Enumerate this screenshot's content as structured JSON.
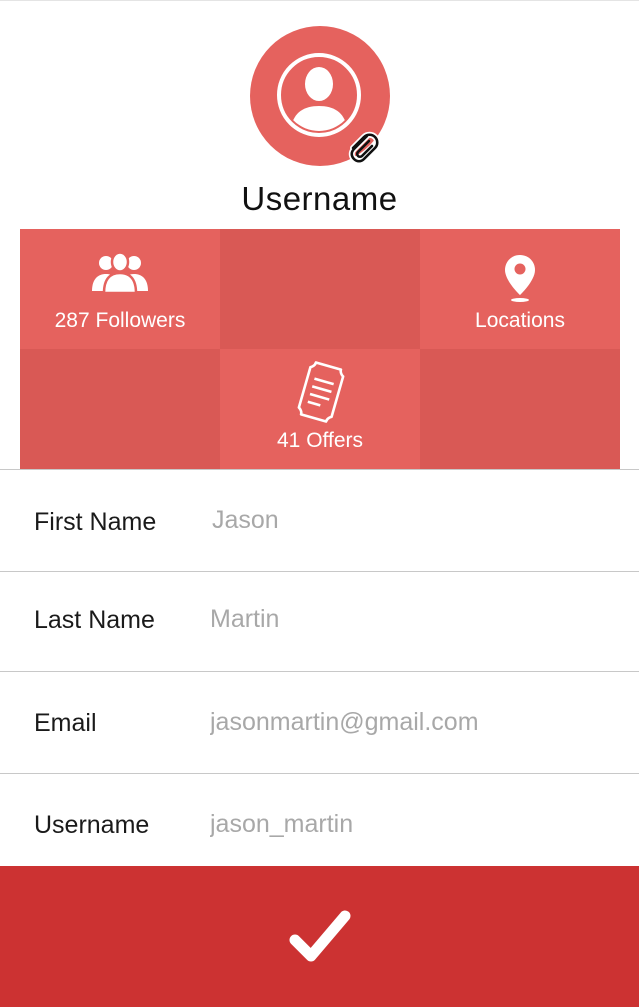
{
  "profile": {
    "username": "Username",
    "avatar_icon": "user-silhouette-icon",
    "attach_icon": "paperclip-icon"
  },
  "stats": {
    "followers_label": "287 Followers",
    "followers_icon": "group-icon",
    "locations_label": "Locations",
    "locations_icon": "map-pin-icon",
    "offers_label": "41 Offers",
    "offers_icon": "ticket-icon"
  },
  "form": {
    "first_name": {
      "label": "First Name",
      "value": "Jason"
    },
    "last_name": {
      "label": "Last Name",
      "value": "Martin"
    },
    "email": {
      "label": "Email",
      "value": "jasonmartin@gmail.com"
    },
    "username": {
      "label": "Username",
      "value": "jason_martin"
    }
  },
  "submit": {
    "icon": "checkmark-icon"
  },
  "colors": {
    "tile_light": "#e5625e",
    "tile_dark": "#d95955",
    "submit_bg": "#cc3232"
  }
}
